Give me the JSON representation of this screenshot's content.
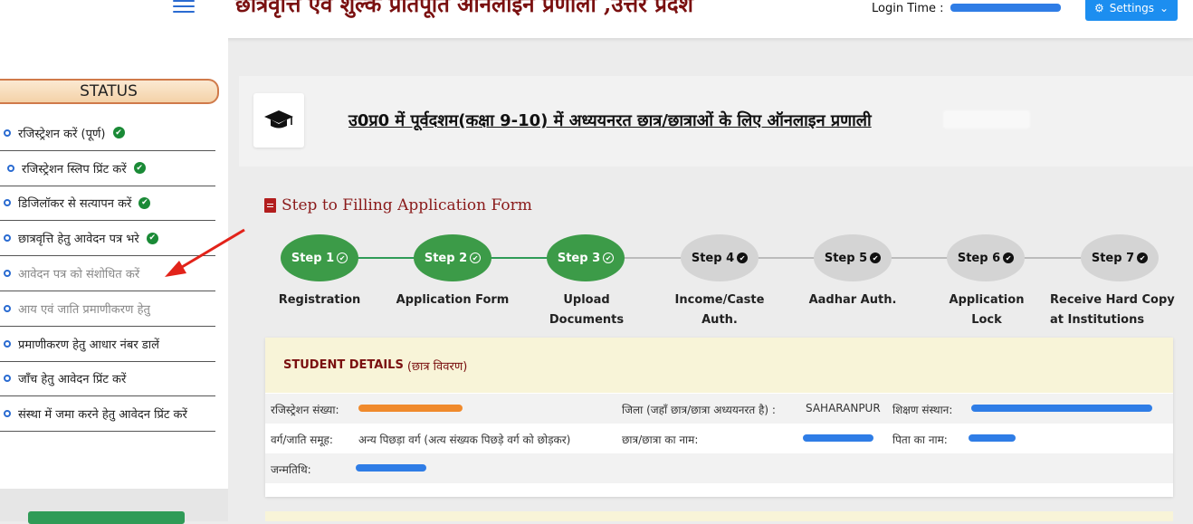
{
  "header": {
    "site_title": "छात्रवृत्ति एवं शुल्क प्रतिपूर्ति ऑनलाइन प्रणाली ,उत्तर प्रदेश",
    "login_label": "Login Time  :",
    "settings_label": "Settings",
    "settings_caret": "⌄",
    "settings_icon": "⚙"
  },
  "sidebar": {
    "status_heading": "STATUS",
    "items": [
      {
        "label": "रजिस्ट्रेशन करें (पूर्ण)",
        "done": true
      },
      {
        "label": "रजिस्ट्रेशन स्लिप प्रिंट करें",
        "done": true
      },
      {
        "label": "डिजिलॉकर से सत्यापन करें",
        "done": true
      },
      {
        "label": "छात्रवृत्ति हेतु आवेदन पत्र भरे",
        "done": true
      },
      {
        "label": "आवेदन पत्र को संशोधित करें",
        "done": false
      },
      {
        "label": "आय एवं जाति प्रमाणीकरण हेतु",
        "done": false
      },
      {
        "label": "प्रमाणीकरण हेतु आधार नंबर डालें",
        "done": false
      },
      {
        "label": "जाँच हेतु आवेदन प्रिंट करें",
        "done": false
      },
      {
        "label": "संस्था में जमा करने हेतु आवेदन प्रिंट करें",
        "done": false
      }
    ],
    "check_glyph": "✔"
  },
  "main": {
    "scheme_title": "उ0प्र0 में पूर्वदशम(कक्षा 9-10) में अध्ययनरत छात्र/छात्राओं के लिए ऑनलाइन प्रणाली",
    "steps_heading": "Step to Filling Application Form",
    "steps": [
      {
        "label": "Step 1",
        "caption": "Registration",
        "state": "done"
      },
      {
        "label": "Step 2",
        "caption": "Application Form",
        "state": "done"
      },
      {
        "label": "Step 3",
        "caption": "Upload Documents",
        "state": "done"
      },
      {
        "label": "Step 4",
        "caption": "Income/Caste Auth.",
        "state": "pending"
      },
      {
        "label": "Step 5",
        "caption": "Aadhar Auth.",
        "state": "pending"
      },
      {
        "label": "Step 6",
        "caption": "Application Lock",
        "state": "pending"
      },
      {
        "label": "Step 7",
        "caption": "Receive Hard Copy at Institutions",
        "state": "pending"
      }
    ],
    "step_mark": "✔"
  },
  "student_details": {
    "heading": "STUDENT DETAILS",
    "heading_hindi": "(छात्र विवरण)",
    "registration_label": "रजिस्ट्रेशन संख्या:",
    "district_label": "जिला (जहाँ छात्र/छात्रा अध्ययनरत है) :",
    "district_value": "SAHARANPUR",
    "institution_label": "शिक्षण संस्थान:",
    "caste_label": "वर्ग/जाति समूह:",
    "caste_value": "अन्य पिछड़ा वर्ग (अत्य संख्यक पिछड़े वर्ग को छोड़कर)",
    "student_name_label": "छात्र/छात्रा का नाम:",
    "father_name_label": "पिता का नाम:",
    "dob_label": "जन्मतिथि:"
  },
  "colors": {
    "title_maroon": "#7a1010",
    "step_done": "#3c9b48",
    "step_pending": "#d4d4d4",
    "redaction_blue": "#2f7de6",
    "redaction_orange": "#f08a2c",
    "annotation_arrow": "#e2231a"
  }
}
